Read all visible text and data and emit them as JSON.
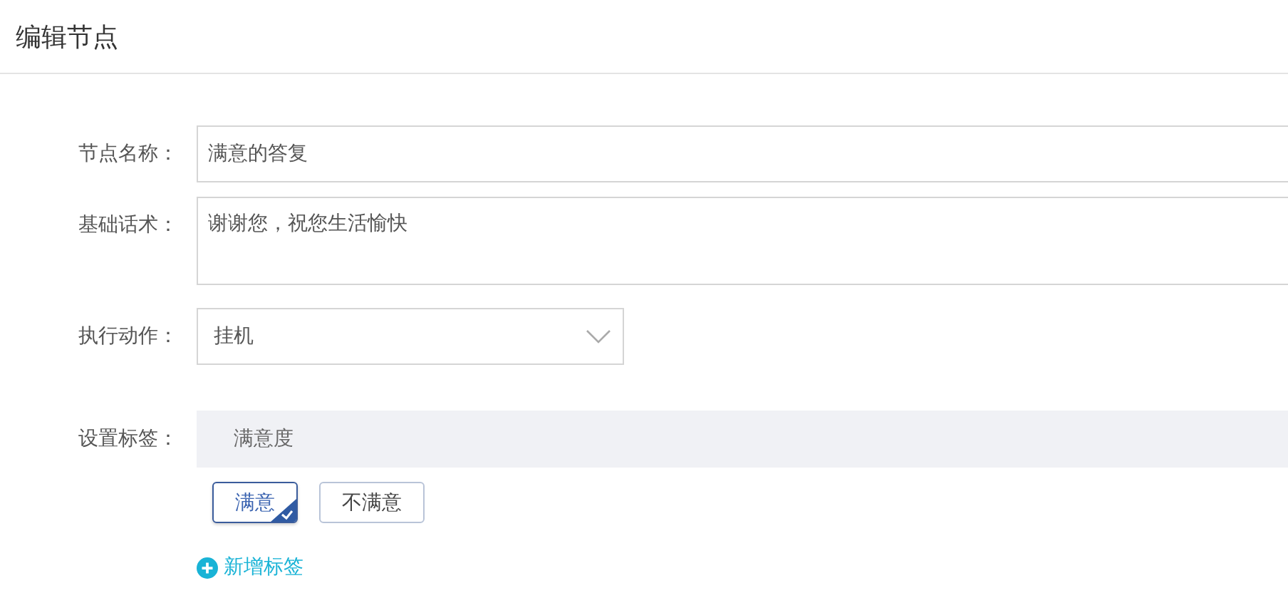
{
  "header": {
    "title": "编辑节点"
  },
  "form": {
    "node_name": {
      "label": "节点名称：",
      "value": "满意的答复"
    },
    "script": {
      "label": "基础话术：",
      "value": "谢谢您，祝您生活愉快"
    },
    "action": {
      "label": "执行动作：",
      "value": "挂机"
    },
    "tags": {
      "label": "设置标签：",
      "group": "满意度",
      "options": [
        {
          "label": "满意",
          "selected": true
        },
        {
          "label": "不满意",
          "selected": false
        }
      ],
      "add_link": "新增标签"
    }
  }
}
